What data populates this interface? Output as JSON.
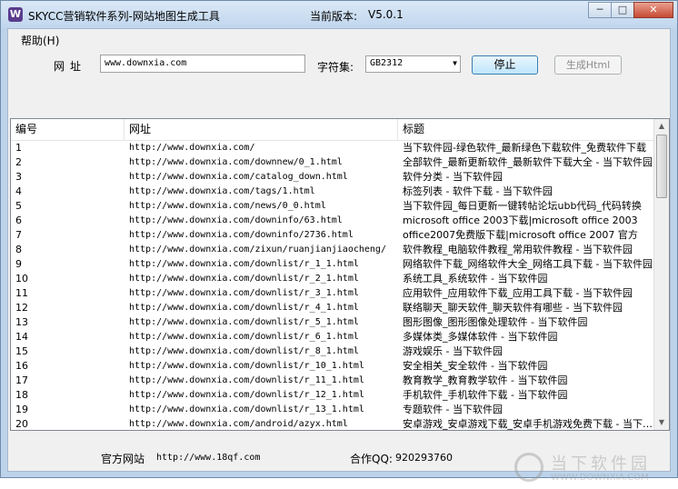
{
  "window": {
    "title": "SKYCC营销软件系列-网站地图生成工具",
    "version_label": "当前版本:",
    "version_value": "V5.0.1",
    "minimize_glyph": "─",
    "maximize_glyph": "□",
    "close_glyph": "✕"
  },
  "menu": {
    "help": "帮助(H)"
  },
  "form": {
    "url_label": "网址",
    "url_value": "www.downxia.com",
    "charset_label": "字符集:",
    "charset_value": "GB2312",
    "stop_button": "停止",
    "generate_button": "生成Html"
  },
  "table": {
    "columns": [
      "编号",
      "网址",
      "标题"
    ],
    "rows": [
      [
        "1",
        "http://www.downxia.com/",
        "当下软件园-绿色软件_最新绿色下载软件_免费软件下载"
      ],
      [
        "2",
        "http://www.downxia.com/downnew/0_1.html",
        "全部软件_最新更新软件_最新软件下载大全 - 当下软件园"
      ],
      [
        "3",
        "http://www.downxia.com/catalog_down.html",
        "软件分类 - 当下软件园"
      ],
      [
        "4",
        "http://www.downxia.com/tags/1.html",
        "标签列表 - 软件下载 - 当下软件园"
      ],
      [
        "5",
        "http://www.downxia.com/news/0_0.html",
        "当下软件园_每日更新一键转帖论坛ubb代码_代码转换"
      ],
      [
        "6",
        "http://www.downxia.com/downinfo/63.html",
        "microsoft office 2003下载|microsoft office 2003"
      ],
      [
        "7",
        "http://www.downxia.com/downinfo/2736.html",
        "office2007免费版下载|microsoft office 2007 官方"
      ],
      [
        "8",
        "http://www.downxia.com/zixun/ruanjianjiaocheng/",
        "软件教程_电脑软件教程_常用软件教程 - 当下软件园"
      ],
      [
        "9",
        "http://www.downxia.com/downlist/r_1_1.html",
        "网络软件下载_网络软件大全_网络工具下载 - 当下软件园"
      ],
      [
        "10",
        "http://www.downxia.com/downlist/r_2_1.html",
        "系统工具_系统软件 - 当下软件园"
      ],
      [
        "11",
        "http://www.downxia.com/downlist/r_3_1.html",
        "应用软件_应用软件下载_应用工具下载 - 当下软件园"
      ],
      [
        "12",
        "http://www.downxia.com/downlist/r_4_1.html",
        "联络聊天_聊天软件_聊天软件有哪些 - 当下软件园"
      ],
      [
        "13",
        "http://www.downxia.com/downlist/r_5_1.html",
        "图形图像_图形图像处理软件 - 当下软件园"
      ],
      [
        "14",
        "http://www.downxia.com/downlist/r_6_1.html",
        "多媒体类_多媒体软件 - 当下软件园"
      ],
      [
        "15",
        "http://www.downxia.com/downlist/r_8_1.html",
        "游戏娱乐 - 当下软件园"
      ],
      [
        "16",
        "http://www.downxia.com/downlist/r_10_1.html",
        "安全相关_安全软件 - 当下软件园"
      ],
      [
        "17",
        "http://www.downxia.com/downlist/r_11_1.html",
        "教育教学_教育教学软件 - 当下软件园"
      ],
      [
        "18",
        "http://www.downxia.com/downlist/r_12_1.html",
        "手机软件_手机软件下载 - 当下软件园"
      ],
      [
        "19",
        "http://www.downxia.com/downlist/r_13_1.html",
        "专题软件 - 当下软件园"
      ],
      [
        "20",
        "http://www.downxia.com/android/azyx.html",
        "安卓游戏_安卓游戏下载_安卓手机游戏免费下载 - 当下软件园"
      ]
    ]
  },
  "footer": {
    "site_label": "官方网站",
    "site_value": "http://www.18qf.com",
    "qq_label": "合作QQ:",
    "qq_value": "920293760"
  },
  "watermark": {
    "cn": "当下软件园",
    "en": "WWW.DOWNXIA.COM"
  },
  "colors": {
    "title_bar": "#c0d6ee",
    "client_bg": "#f0f0f0",
    "close_button": "#c74a34"
  }
}
